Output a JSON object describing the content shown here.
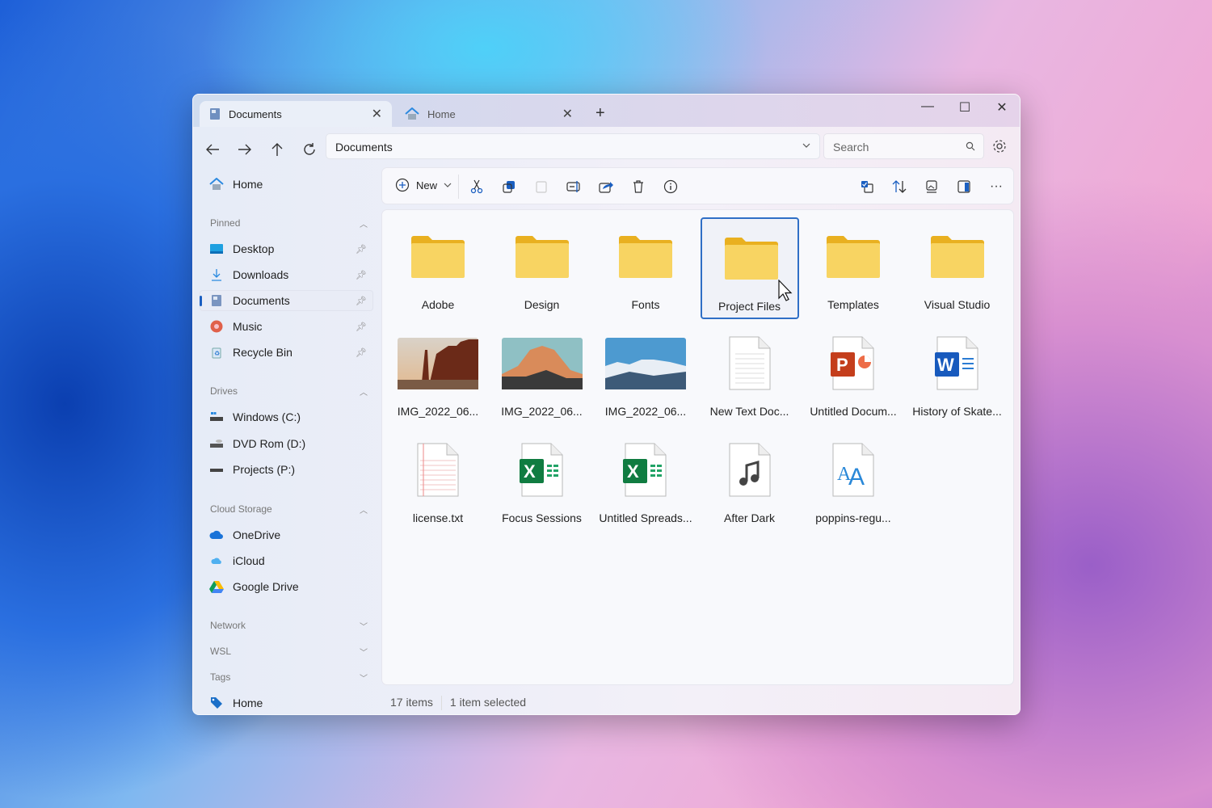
{
  "tabs": [
    {
      "label": "Documents",
      "icon": "documents-icon",
      "active": true
    },
    {
      "label": "Home",
      "icon": "home-icon",
      "active": false
    }
  ],
  "address": {
    "path": "Documents"
  },
  "search": {
    "placeholder": "Search"
  },
  "sidebar": {
    "home": "Home",
    "sections": [
      {
        "title": "Pinned",
        "expanded": true,
        "items": [
          "Desktop",
          "Downloads",
          "Documents",
          "Music",
          "Recycle Bin"
        ]
      },
      {
        "title": "Drives",
        "expanded": true,
        "items": [
          "Windows (C:)",
          "DVD Rom (D:)",
          "Projects (P:)"
        ]
      },
      {
        "title": "Cloud Storage",
        "expanded": true,
        "items": [
          "OneDrive",
          "iCloud",
          "Google Drive"
        ]
      },
      {
        "title": "Network",
        "expanded": false
      },
      {
        "title": "WSL",
        "expanded": false
      },
      {
        "title": "Tags",
        "expanded": false,
        "items": [
          "Home"
        ]
      }
    ],
    "selected": "Documents"
  },
  "toolbar": {
    "new_label": "New"
  },
  "files": [
    {
      "name": "Adobe",
      "type": "folder"
    },
    {
      "name": "Design",
      "type": "folder"
    },
    {
      "name": "Fonts",
      "type": "folder"
    },
    {
      "name": "Project Files",
      "type": "folder",
      "selected": true
    },
    {
      "name": "Templates",
      "type": "folder"
    },
    {
      "name": "Visual Studio",
      "type": "folder"
    },
    {
      "name": "IMG_2022_06...",
      "type": "image-desert"
    },
    {
      "name": "IMG_2022_06...",
      "type": "image-mountain"
    },
    {
      "name": "IMG_2022_06...",
      "type": "image-snow"
    },
    {
      "name": "New Text Doc...",
      "type": "text"
    },
    {
      "name": "Untitled Docum...",
      "type": "powerpoint"
    },
    {
      "name": "History of Skate...",
      "type": "word"
    },
    {
      "name": "license.txt",
      "type": "license"
    },
    {
      "name": "Focus Sessions",
      "type": "excel"
    },
    {
      "name": "Untitled Spreads...",
      "type": "excel"
    },
    {
      "name": "After Dark",
      "type": "audio"
    },
    {
      "name": "poppins-regu...",
      "type": "font"
    }
  ],
  "status": {
    "count": "17 items",
    "selection": "1 item selected"
  },
  "colors": {
    "accent": "#1b5fc1",
    "folder": "#f7cf5b"
  }
}
